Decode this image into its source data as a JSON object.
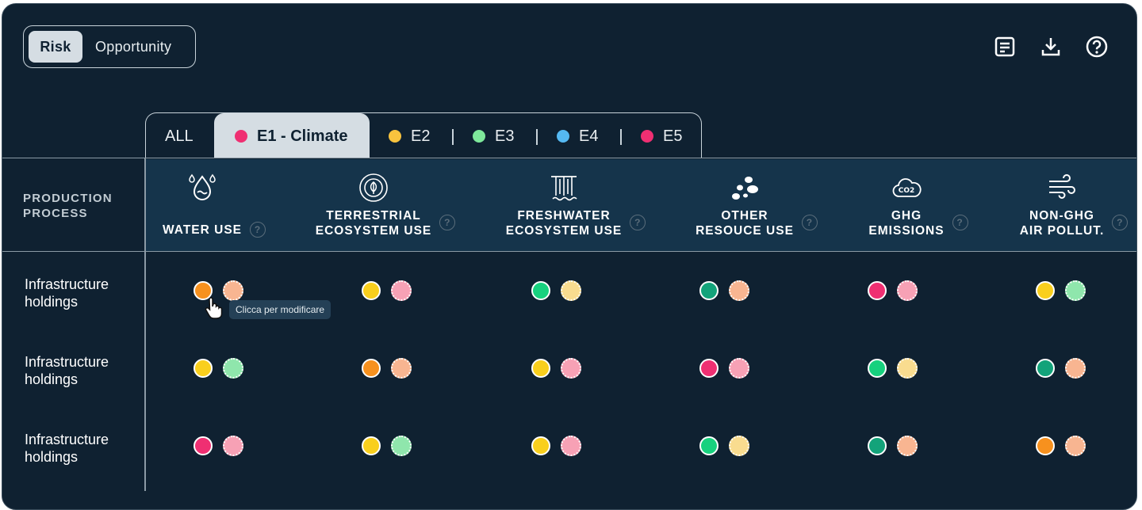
{
  "toggle": {
    "risk_label": "Risk",
    "opportunity_label": "Opportunity",
    "selected": "Risk"
  },
  "toolbar_icons": [
    "notes-icon",
    "download-icon",
    "help-icon"
  ],
  "tabs": {
    "all": "ALL",
    "items": [
      {
        "label": "E1 - Climate",
        "color": "#ef2f72",
        "active": true
      },
      {
        "label": "E2",
        "color": "#f9c33e"
      },
      {
        "label": "E3",
        "color": "#7ee89b"
      },
      {
        "label": "E4",
        "color": "#55b9f2"
      },
      {
        "label": "E5",
        "color": "#ef2f72"
      }
    ]
  },
  "header": {
    "row_header_line1": "PRODUCTION",
    "row_header_line2": "PROCESS",
    "columns": [
      {
        "line1": "WATER USE",
        "line2": "",
        "icon": "water-drop-icon"
      },
      {
        "line1": "TERRESTRIAL",
        "line2": "ECOSYSTEM USE",
        "icon": "leaf-circle-icon"
      },
      {
        "line1": "FRESHWATER",
        "line2": "ECOSYSTEM USE",
        "icon": "waterfall-icon"
      },
      {
        "line1": "OTHER",
        "line2": "RESOUCE USE",
        "icon": "stones-icon"
      },
      {
        "line1": "GHG",
        "line2": "EMISSIONS",
        "icon": "co2-cloud-icon"
      },
      {
        "line1": "NON-GHG",
        "line2": "AIR POLLUT.",
        "icon": "wind-icon"
      }
    ]
  },
  "rows": [
    {
      "label1": "Infrastructure",
      "label2": "holdings",
      "cells": [
        [
          "#f7911e",
          "#f8b591"
        ],
        [
          "#f9cf1d",
          "#f7a1b5"
        ],
        [
          "#17d17e",
          "#f9dc8f"
        ],
        [
          "#13a37a",
          "#f8b591"
        ],
        [
          "#ef2f72",
          "#f7a1b5"
        ],
        [
          "#f9cf1d",
          "#8fe6ac"
        ]
      ]
    },
    {
      "label1": "Infrastructure",
      "label2": "holdings",
      "cells": [
        [
          "#f9cf1d",
          "#8fe6ac"
        ],
        [
          "#f7911e",
          "#f8b591"
        ],
        [
          "#f9cf1d",
          "#f7a1b5"
        ],
        [
          "#ef2f72",
          "#f7a1b5"
        ],
        [
          "#17d17e",
          "#f9dc8f"
        ],
        [
          "#13a37a",
          "#f8b591"
        ]
      ]
    },
    {
      "label1": "Infrastructure",
      "label2": "holdings",
      "cells": [
        [
          "#ef2f72",
          "#f7a1b5"
        ],
        [
          "#f9cf1d",
          "#8fe6ac"
        ],
        [
          "#f9cf1d",
          "#f7a1b5"
        ],
        [
          "#17d17e",
          "#f9dc8f"
        ],
        [
          "#13a37a",
          "#f8b591"
        ],
        [
          "#f7911e",
          "#f8b591"
        ]
      ]
    }
  ],
  "tooltip": "Clicca per modificare"
}
